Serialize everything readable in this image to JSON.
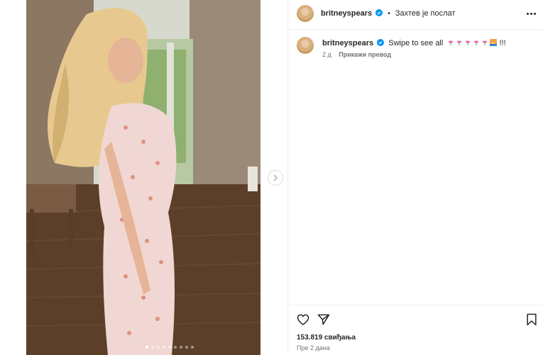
{
  "post": {
    "media_alt": "Woman in a floral dress with long blonde hair standing in a room",
    "carousel_dots": 9,
    "carousel_active_index": 0
  },
  "header": {
    "username": "britneyspears",
    "separator": "•",
    "follow_status": "Захтев је послат"
  },
  "caption": {
    "username": "britneyspears",
    "text": "Swipe to see all",
    "trailing": "!!!",
    "time_ago": "2 д",
    "translate_label": "Прикажи превод"
  },
  "footer": {
    "likes": "153.819 свиђања",
    "posted": "Пре 2 дана"
  },
  "colors": {
    "verified": "#0095f6",
    "text": "#262626",
    "muted": "#737373",
    "divider": "#efefef"
  }
}
